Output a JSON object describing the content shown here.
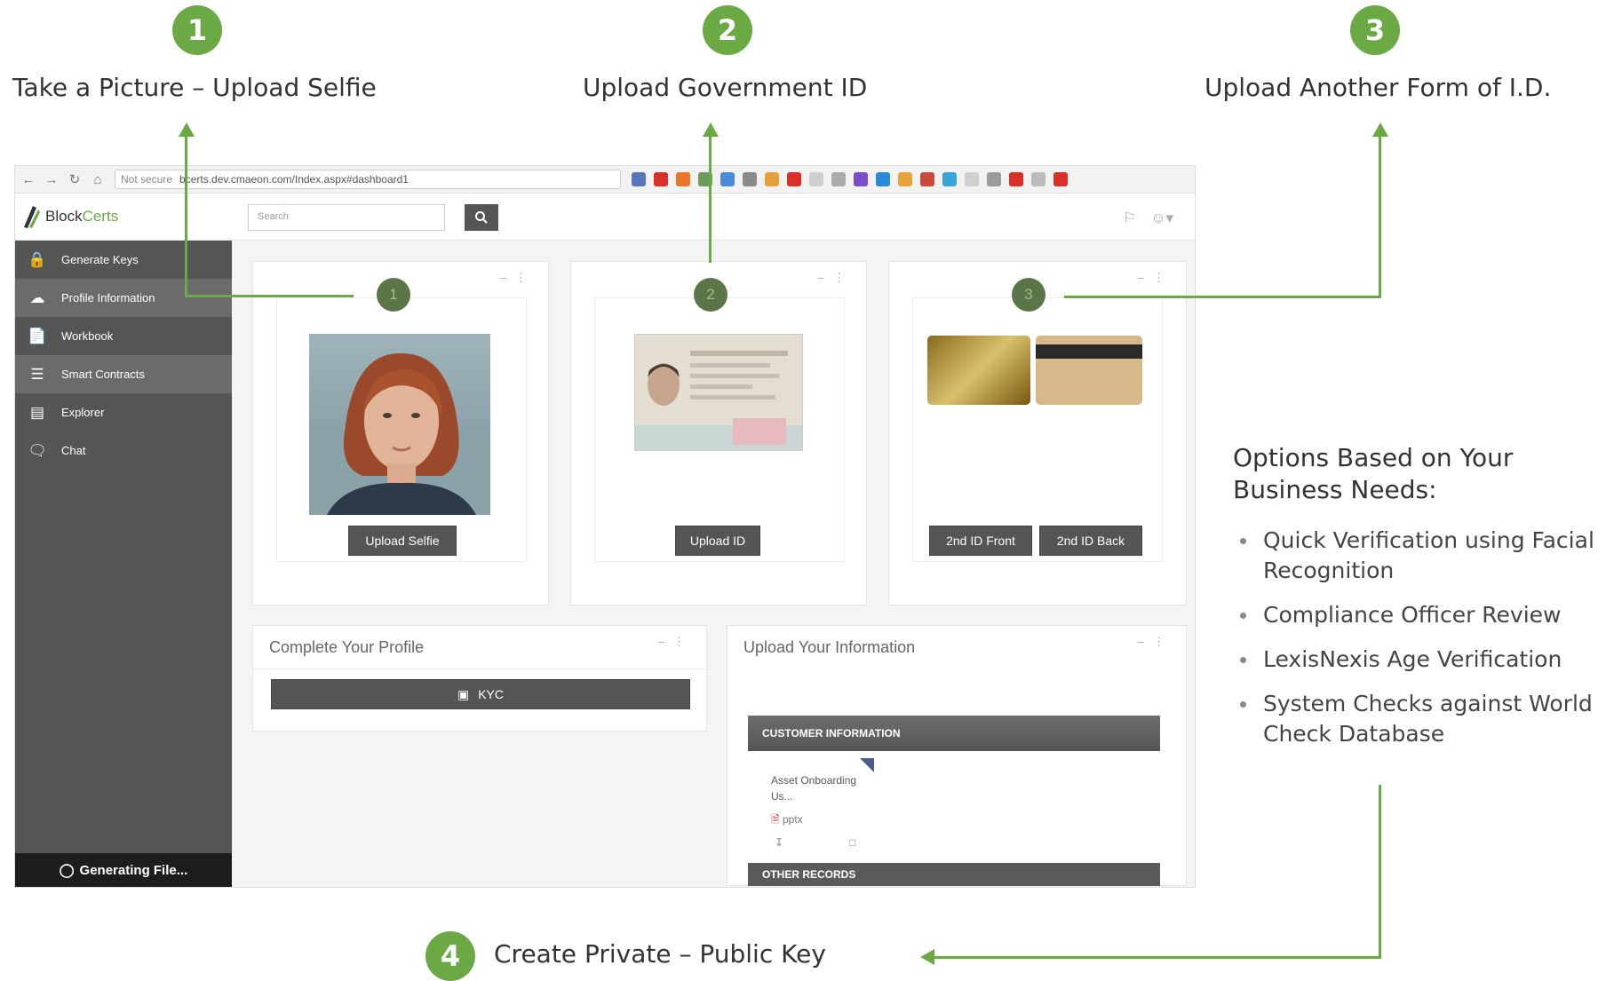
{
  "steps": [
    {
      "number": "1",
      "label": "Take a Picture – Upload Selfie"
    },
    {
      "number": "2",
      "label": "Upload Government ID"
    },
    {
      "number": "3",
      "label": "Upload Another Form of I.D."
    },
    {
      "number": "4",
      "label": "Create Private – Public Key"
    }
  ],
  "options": {
    "title_line1": "Options Based on Your",
    "title_line2": "Business Needs:",
    "items": [
      "Quick Verification using Facial Recognition",
      "Compliance Officer Review",
      "LexisNexis Age Verification",
      "System Checks against World Check Database"
    ]
  },
  "browser": {
    "not_secure": "Not secure",
    "url": "bcerts.dev.cmaeon.com/Index.aspx#dashboard1"
  },
  "app": {
    "logo_prefix": "Block",
    "logo_suffix": "Certs",
    "search_placeholder": "Search",
    "sidebar": [
      {
        "label": "Generate Keys",
        "icon": "lock-icon"
      },
      {
        "label": "Profile Information",
        "icon": "cloud-icon"
      },
      {
        "label": "Workbook",
        "icon": "document-icon"
      },
      {
        "label": "Smart Contracts",
        "icon": "list-icon"
      },
      {
        "label": "Explorer",
        "icon": "chart-icon"
      },
      {
        "label": "Chat",
        "icon": "chat-icon"
      }
    ],
    "footer_status": "Generating File...",
    "cards": [
      {
        "number": "1",
        "buttons": [
          "Upload Selfie"
        ]
      },
      {
        "number": "2",
        "buttons": [
          "Upload ID"
        ]
      },
      {
        "number": "3",
        "buttons": [
          "2nd ID Front",
          "2nd ID Back"
        ]
      }
    ],
    "complete_profile": {
      "title": "Complete Your Profile",
      "button": "KYC"
    },
    "upload_info": {
      "title": "Upload Your Information",
      "customer_bar": "CUSTOMER INFORMATION",
      "asset_name": "Asset Onboarding Us...",
      "asset_ext": "pptx",
      "other_bar": "OTHER RECORDS"
    }
  },
  "colors": {
    "accent_green": "#6aa943",
    "sidebar": "#555555"
  }
}
